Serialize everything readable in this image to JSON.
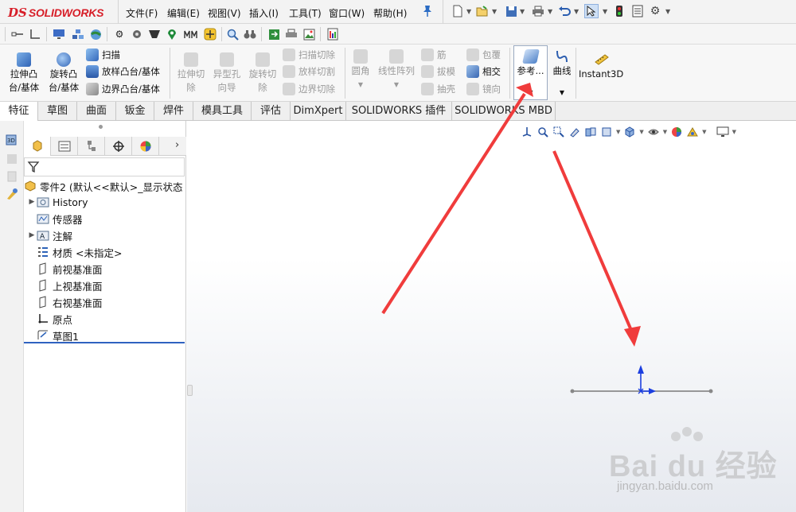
{
  "app": {
    "logo_ds": "DS",
    "logo_text": "SOLIDWORKS"
  },
  "menu": {
    "items": [
      "文件(F)",
      "编辑(E)",
      "视图(V)",
      "插入(I)",
      "工具(T)",
      "窗口(W)",
      "帮助(H)"
    ]
  },
  "quick_access": {
    "icons": [
      "new-document-icon",
      "open-icon",
      "save-icon",
      "print-icon",
      "undo-icon",
      "select-icon",
      "rebuild-icon",
      "file-properties-icon",
      "options-icon"
    ]
  },
  "toolbar2": {
    "icons": [
      "mate-icon",
      "sketch-relation-icon",
      "display-icon",
      "assembly-icon",
      "appearance-icon",
      "options-gear-icon",
      "settings-icon",
      "section-icon",
      "location-icon",
      "dimension-icon",
      "move-icon",
      "zoom-icon",
      "binoculars-icon",
      "export-icon",
      "print-preview-icon",
      "image-icon",
      "report-icon"
    ]
  },
  "ribbon": {
    "extrude_boss": "拉伸凸\n台/基体",
    "extrude_boss_l1": "拉伸凸",
    "extrude_boss_l2": "台/基体",
    "revolve_boss_l1": "旋转凸",
    "revolve_boss_l2": "台/基体",
    "sweep": "扫描",
    "loft": "放样凸台/基体",
    "boundary": "边界凸台/基体",
    "extrude_cut_l1": "拉伸切",
    "extrude_cut_l2": "除",
    "hole_wizard_l1": "异型孔",
    "hole_wizard_l2": "向导",
    "revolve_cut_l1": "旋转切",
    "revolve_cut_l2": "除",
    "swept_cut": "扫描切除",
    "lofted_cut": "放样切割",
    "boundary_cut": "边界切除",
    "fillet": "圆角",
    "linear_pattern": "线性阵列",
    "rib": "筋",
    "draft": "拔模",
    "shell": "抽壳",
    "wrap": "包覆",
    "intersect": "相交",
    "mirror": "镜向",
    "reference": "参考...",
    "curves": "曲线",
    "instant3d": "Instant3D"
  },
  "tabs": [
    {
      "label": "特征",
      "active": true
    },
    {
      "label": "草图",
      "active": false
    },
    {
      "label": "曲面",
      "active": false
    },
    {
      "label": "钣金",
      "active": false
    },
    {
      "label": "焊件",
      "active": false
    },
    {
      "label": "模具工具",
      "active": false
    },
    {
      "label": "评估",
      "active": false
    },
    {
      "label": "DimXpert",
      "active": false
    },
    {
      "label": "SOLIDWORKS 插件",
      "active": false
    },
    {
      "label": "SOLIDWORKS MBD",
      "active": false
    }
  ],
  "feature_tree": {
    "root": "零件2  (默认<<默认>_显示状态",
    "items": [
      {
        "label": "History",
        "expandable": true,
        "icon": "history-folder-icon"
      },
      {
        "label": "传感器",
        "expandable": false,
        "icon": "sensor-icon"
      },
      {
        "label": "注解",
        "expandable": true,
        "icon": "annotation-icon"
      },
      {
        "label": "材质 <未指定>",
        "expandable": false,
        "icon": "material-icon"
      },
      {
        "label": "前视基准面",
        "expandable": false,
        "icon": "plane-icon"
      },
      {
        "label": "上视基准面",
        "expandable": false,
        "icon": "plane-icon"
      },
      {
        "label": "右视基准面",
        "expandable": false,
        "icon": "plane-icon"
      },
      {
        "label": "原点",
        "expandable": false,
        "icon": "origin-icon"
      },
      {
        "label": "草图1",
        "expandable": false,
        "icon": "sketch-icon"
      }
    ]
  },
  "watermark": {
    "main": "Bai du 经验",
    "sub": "jingyan.baidu.com"
  },
  "colors": {
    "brand_red": "#d71e28",
    "arrow_red": "#f03c3c",
    "axis_blue": "#1c3fe0",
    "tree_bar": "#2f62c0"
  }
}
